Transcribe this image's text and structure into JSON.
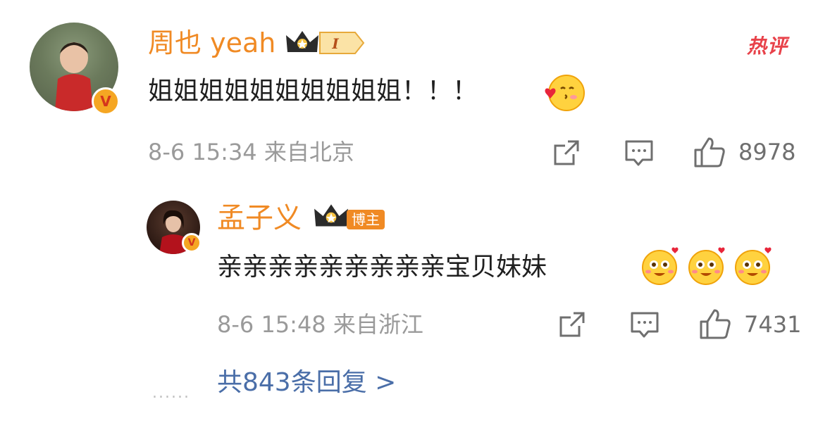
{
  "comment": {
    "username": "周也 yeah",
    "level_badge": "I",
    "hot_label": "热评",
    "text": "姐姐姐姐姐姐姐姐姐姐！！！",
    "emoji": "kiss-heart-emoji",
    "meta": "8-6 15:34 来自北京",
    "likes": "8978",
    "verified_badge": "V"
  },
  "reply": {
    "username": "孟子义",
    "role_badge": "博主",
    "text": "亲亲亲亲亲亲亲亲亲宝贝妹妹",
    "emoji": "blushing-heart-emoji",
    "meta": "8-6 15:48 来自浙江",
    "likes": "7431",
    "verified_badge": "V"
  },
  "replies_link": {
    "dots": "......",
    "label": "共843条回复 >"
  },
  "colors": {
    "username": "#f08a24",
    "hot": "#e8424a",
    "link": "#4a6ea8",
    "meta": "#9a9a9a"
  }
}
